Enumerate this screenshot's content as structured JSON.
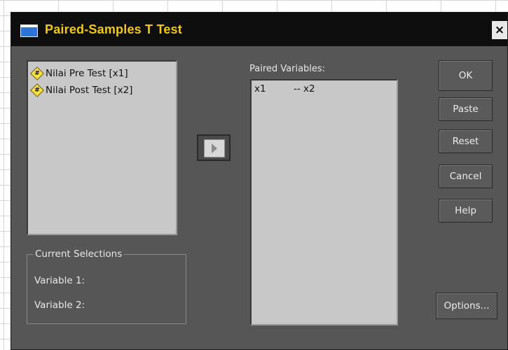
{
  "dialog": {
    "title": "Paired-Samples T Test",
    "close_label": "×"
  },
  "source_variables": [
    {
      "label": "Nilai Pre Test [x1]",
      "icon": "scale-variable-icon"
    },
    {
      "label": "Nilai Post Test [x2]",
      "icon": "scale-variable-icon"
    }
  ],
  "paired": {
    "label": "Paired Variables:",
    "rows": [
      {
        "var1": "x1",
        "var2": "-- x2"
      }
    ]
  },
  "buttons": {
    "ok": "OK",
    "paste": "Paste",
    "reset": "Reset",
    "cancel": "Cancel",
    "help": "Help",
    "options": "Options..."
  },
  "current_selections": {
    "title": "Current Selections",
    "variable1": "Variable 1:",
    "variable2": "Variable 2:"
  },
  "colors": {
    "title_text": "#f2c71e",
    "dialog_bg": "#565656",
    "list_bg": "#c8c8c8"
  }
}
